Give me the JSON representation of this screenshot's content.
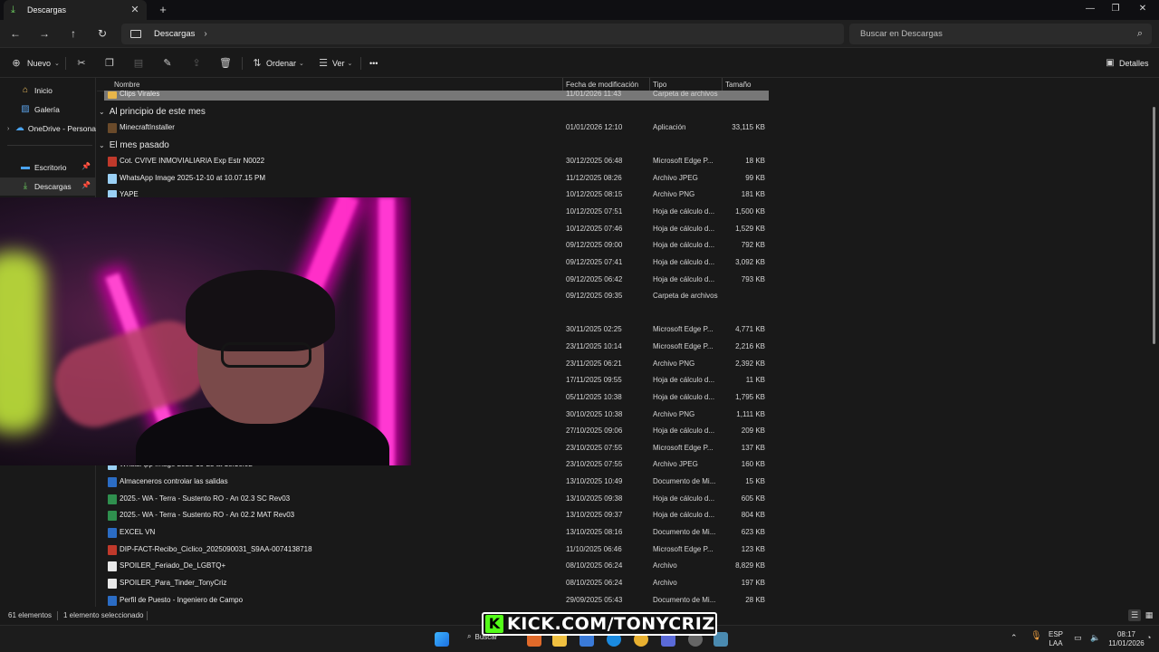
{
  "window": {
    "tab_title": "Descargas",
    "tab_close": "✕",
    "new_tab": "+",
    "minimize": "—",
    "maximize": "❐",
    "close": "✕"
  },
  "nav": {
    "back": "←",
    "forward": "→",
    "up": "↑",
    "refresh": "↻",
    "breadcrumb": "Descargas",
    "breadcrumb_sep": "›",
    "search_placeholder": "Buscar en Descargas",
    "search_icon": "⌕"
  },
  "toolbar": {
    "new_label": "Nuevo",
    "sort_label": "Ordenar",
    "view_label": "Ver",
    "more_label": "•••",
    "details_label": "Detalles"
  },
  "sidebar": {
    "items": [
      {
        "label": "Inicio",
        "icon": "home-icon"
      },
      {
        "label": "Galería",
        "icon": "gallery-icon"
      },
      {
        "label": "OneDrive - Persona",
        "icon": "cloud-icon"
      },
      {
        "label": "Escritorio",
        "icon": "desktop-icon"
      },
      {
        "label": "Descargas",
        "icon": "download-icon"
      }
    ]
  },
  "columns": {
    "name": "Nombre",
    "date": "Fecha de modificación",
    "type": "Tipo",
    "size": "Tamaño"
  },
  "groups": {
    "this_month": "Al principio de este mes",
    "last_month": "El mes pasado"
  },
  "files": [
    {
      "name": "Clips Virales",
      "date": "11/01/2026 11:43",
      "type": "Carpeta de archivos",
      "size": "",
      "kind": "folder"
    },
    {
      "name": "MinecraftInstaller",
      "date": "01/01/2026 12:10",
      "type": "Aplicación",
      "size": "33,115 KB",
      "kind": "app"
    },
    {
      "name": "Cot. CVIVE INMOVIALIARIA Exp Estr N0022",
      "date": "30/12/2025 06:48",
      "type": "Microsoft Edge P...",
      "size": "18 KB",
      "kind": "pdf"
    },
    {
      "name": "WhatsApp Image 2025-12-10 at 10.07.15 PM",
      "date": "11/12/2025 08:26",
      "type": "Archivo JPEG",
      "size": "99 KB",
      "kind": "image"
    },
    {
      "name": "YAPE",
      "date": "10/12/2025 08:15",
      "type": "Archivo PNG",
      "size": "181 KB",
      "kind": "image"
    },
    {
      "name": "",
      "date": "10/12/2025 07:51",
      "type": "Hoja de cálculo d...",
      "size": "1,500 KB",
      "kind": "excel"
    },
    {
      "name": "",
      "date": "10/12/2025 07:46",
      "type": "Hoja de cálculo d...",
      "size": "1,529 KB",
      "kind": "excel"
    },
    {
      "name": "",
      "date": "09/12/2025 09:00",
      "type": "Hoja de cálculo d...",
      "size": "792 KB",
      "kind": "excel"
    },
    {
      "name": "",
      "date": "09/12/2025 07:41",
      "type": "Hoja de cálculo d...",
      "size": "3,092 KB",
      "kind": "excel"
    },
    {
      "name": "",
      "date": "09/12/2025 06:42",
      "type": "Hoja de cálculo d...",
      "size": "793 KB",
      "kind": "excel"
    },
    {
      "name": "",
      "date": "09/12/2025 09:35",
      "type": "Carpeta de archivos",
      "size": "",
      "kind": "folder"
    },
    {
      "name": "",
      "date": "30/11/2025 02:25",
      "type": "Microsoft Edge P...",
      "size": "4,771 KB",
      "kind": "pdf"
    },
    {
      "name": "",
      "date": "23/11/2025 10:14",
      "type": "Microsoft Edge P...",
      "size": "2,216 KB",
      "kind": "pdf"
    },
    {
      "name": "",
      "date": "23/11/2025 06:21",
      "type": "Archivo PNG",
      "size": "2,392 KB",
      "kind": "image"
    },
    {
      "name": "",
      "date": "17/11/2025 09:55",
      "type": "Hoja de cálculo d...",
      "size": "11 KB",
      "kind": "excel"
    },
    {
      "name": "",
      "date": "05/11/2025 10:38",
      "type": "Hoja de cálculo d...",
      "size": "1,795 KB",
      "kind": "excel"
    },
    {
      "name": "",
      "date": "30/10/2025 10:38",
      "type": "Archivo PNG",
      "size": "1,111 KB",
      "kind": "image"
    },
    {
      "name": "",
      "date": "27/10/2025 09:06",
      "type": "Hoja de cálculo d...",
      "size": "209 KB",
      "kind": "excel"
    },
    {
      "name": "",
      "date": "23/10/2025 07:55",
      "type": "Microsoft Edge P...",
      "size": "137 KB",
      "kind": "pdf"
    },
    {
      "name": "WhatsApp Image 2025-10-23 at 18.16.02",
      "date": "23/10/2025 07:55",
      "type": "Archivo JPEG",
      "size": "160 KB",
      "kind": "image"
    },
    {
      "name": "Almaceneros controlar las salidas",
      "date": "13/10/2025 10:49",
      "type": "Documento de Mi...",
      "size": "15 KB",
      "kind": "word"
    },
    {
      "name": "2025.- WA - Terra - Sustento RO - An 02.3 SC Rev03",
      "date": "13/10/2025 09:38",
      "type": "Hoja de cálculo d...",
      "size": "605 KB",
      "kind": "excel"
    },
    {
      "name": "2025.- WA - Terra - Sustento RO - An 02.2 MAT Rev03",
      "date": "13/10/2025 09:37",
      "type": "Hoja de cálculo d...",
      "size": "804 KB",
      "kind": "excel"
    },
    {
      "name": "EXCEL VN",
      "date": "13/10/2025 08:16",
      "type": "Documento de Mi...",
      "size": "623 KB",
      "kind": "word"
    },
    {
      "name": "DIP-FACT-Recibo_Ciclico_2025090031_S9AA-0074138718",
      "date": "11/10/2025 06:46",
      "type": "Microsoft Edge P...",
      "size": "123 KB",
      "kind": "pdf"
    },
    {
      "name": "SPOILER_Feriado_De_LGBTQ+",
      "date": "08/10/2025 06:24",
      "type": "Archivo",
      "size": "8,829 KB",
      "kind": "file"
    },
    {
      "name": "SPOILER_Para_Tinder_TonyCriz",
      "date": "08/10/2025 06:24",
      "type": "Archivo",
      "size": "197 KB",
      "kind": "file"
    },
    {
      "name": "Perfil de Puesto - Ingeniero de Campo",
      "date": "29/09/2025 05:43",
      "type": "Documento de Mi...",
      "size": "28 KB",
      "kind": "word"
    }
  ],
  "status": {
    "count": "61 elementos",
    "selected": "1 elemento seleccionado"
  },
  "taskbar": {
    "search_label": "Buscar",
    "lang_top": "ESP",
    "lang_bottom": "LAA",
    "time": "08:17",
    "date": "11/01/2026"
  },
  "overlay": {
    "kick_badge": "K",
    "kick_text": "KICK.COM/TONYCRIZ"
  },
  "colors": {
    "folder": "#e8b64a",
    "excel": "#2f8f4e",
    "pdf": "#c0392b",
    "word": "#2b6cc4",
    "image": "#9ad0f5",
    "app": "#6a4a2a",
    "file": "#e8e8e8",
    "kick_green": "#53fc18"
  }
}
